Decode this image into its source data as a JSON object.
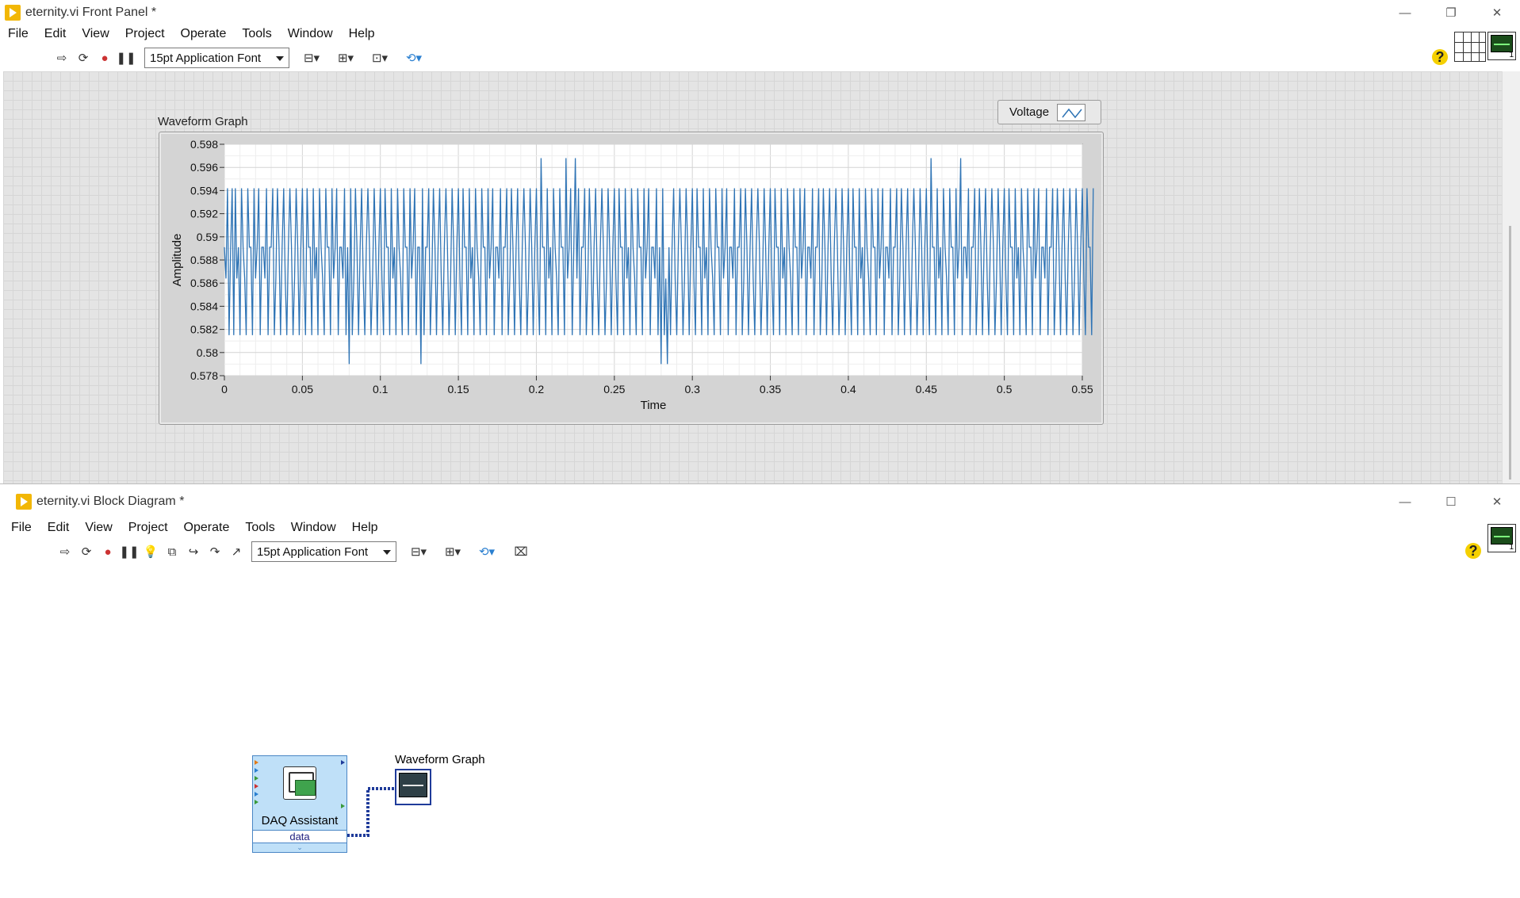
{
  "front_panel": {
    "title": "eternity.vi Front Panel *",
    "menu": [
      "File",
      "Edit",
      "View",
      "Project",
      "Operate",
      "Tools",
      "Window",
      "Help"
    ],
    "font_select": "15pt Application Font",
    "graph_label": "Waveform Graph",
    "legend_label": "Voltage"
  },
  "block_diagram": {
    "title": "eternity.vi Block Diagram *",
    "menu": [
      "File",
      "Edit",
      "View",
      "Project",
      "Operate",
      "Tools",
      "Window",
      "Help"
    ],
    "font_select": "15pt Application Font",
    "daq_title": "DAQ Assistant",
    "daq_output": "data",
    "graph_terminal_label": "Waveform Graph"
  },
  "window_controls": {
    "minimize": "—",
    "restore": "❐",
    "maximize": "☐",
    "close": "✕"
  },
  "chart_data": {
    "type": "line",
    "title": "Waveform Graph",
    "xlabel": "Time",
    "ylabel": "Amplitude",
    "xlim": [
      0,
      0.55
    ],
    "ylim": [
      0.578,
      0.598
    ],
    "xticks": [
      "0",
      "0.05",
      "0.1",
      "0.15",
      "0.2",
      "0.25",
      "0.3",
      "0.35",
      "0.4",
      "0.45",
      "0.5",
      "0.55"
    ],
    "yticks": [
      "0.578",
      "0.58",
      "0.582",
      "0.584",
      "0.586",
      "0.588",
      "0.59",
      "0.592",
      "0.594",
      "0.596",
      "0.598"
    ],
    "grid": true,
    "series": [
      {
        "name": "Voltage",
        "color": "#2f74b5",
        "x_start": 0,
        "x_step": 0.001,
        "values": [
          0.5891,
          0.5864,
          0.5942,
          0.5815,
          0.5891,
          0.5942,
          0.5815,
          0.5942,
          0.5864,
          0.5891,
          0.5815,
          0.5942,
          0.5891,
          0.5864,
          0.5815,
          0.5942,
          0.5891,
          0.5891,
          0.5815,
          0.5942,
          0.5864,
          0.5891,
          0.5942,
          0.5815,
          0.5891,
          0.5891,
          0.5864,
          0.5942,
          0.5815,
          0.5891,
          0.5891,
          0.5942,
          0.5815,
          0.5864,
          0.5942,
          0.5891,
          0.5815,
          0.5891,
          0.5942,
          0.5864,
          0.5815,
          0.5891,
          0.5942,
          0.5891,
          0.5815,
          0.5864,
          0.5942,
          0.5891,
          0.5815,
          0.5891,
          0.5942,
          0.5864,
          0.5815,
          0.5942,
          0.5891,
          0.5891,
          0.5815,
          0.5942,
          0.5864,
          0.5891,
          0.5815,
          0.5942,
          0.5891,
          0.5864,
          0.5815,
          0.5942,
          0.5891,
          0.5891,
          0.5815,
          0.5942,
          0.5864,
          0.5891,
          0.5942,
          0.5815,
          0.5891,
          0.5891,
          0.5864,
          0.5942,
          0.5815,
          0.5891,
          0.579,
          0.5942,
          0.5815,
          0.5864,
          0.5942,
          0.5891,
          0.5815,
          0.5891,
          0.5942,
          0.5864,
          0.5815,
          0.5891,
          0.5942,
          0.5891,
          0.5815,
          0.5864,
          0.5942,
          0.5891,
          0.5815,
          0.5891,
          0.5942,
          0.5864,
          0.5815,
          0.5942,
          0.5891,
          0.5891,
          0.5815,
          0.5942,
          0.5864,
          0.5891,
          0.5815,
          0.5942,
          0.5891,
          0.5864,
          0.5815,
          0.5942,
          0.5891,
          0.5891,
          0.5815,
          0.5942,
          0.5864,
          0.5891,
          0.5942,
          0.5815,
          0.5891,
          0.5891,
          0.579,
          0.5942,
          0.5815,
          0.5891,
          0.5891,
          0.5942,
          0.5815,
          0.5864,
          0.5942,
          0.5891,
          0.5815,
          0.5891,
          0.5942,
          0.5864,
          0.5815,
          0.5891,
          0.5942,
          0.5891,
          0.5815,
          0.5864,
          0.5942,
          0.5891,
          0.5815,
          0.5891,
          0.5942,
          0.5864,
          0.5815,
          0.5942,
          0.5891,
          0.5891,
          0.5815,
          0.5942,
          0.5864,
          0.5891,
          0.5815,
          0.5942,
          0.5891,
          0.5864,
          0.5815,
          0.5942,
          0.5891,
          0.5891,
          0.5815,
          0.5942,
          0.5864,
          0.5891,
          0.5942,
          0.5815,
          0.5891,
          0.5891,
          0.5864,
          0.5942,
          0.5815,
          0.5891,
          0.5891,
          0.5942,
          0.5815,
          0.5864,
          0.5942,
          0.5891,
          0.5815,
          0.5891,
          0.5942,
          0.5864,
          0.5815,
          0.5891,
          0.5942,
          0.5891,
          0.5815,
          0.5864,
          0.5942,
          0.5891,
          0.5815,
          0.5891,
          0.5942,
          0.5864,
          0.5815,
          0.5968,
          0.5891,
          0.5891,
          0.5815,
          0.5942,
          0.5864,
          0.5891,
          0.5815,
          0.5942,
          0.5891,
          0.5864,
          0.5815,
          0.5942,
          0.5891,
          0.5891,
          0.5815,
          0.5968,
          0.5864,
          0.5891,
          0.5942,
          0.5815,
          0.5891,
          0.5968,
          0.5864,
          0.5942,
          0.5815,
          0.5891,
          0.5891,
          0.5942,
          0.5815,
          0.5864,
          0.5942,
          0.5891,
          0.5815,
          0.5891,
          0.5942,
          0.5864,
          0.5815,
          0.5891,
          0.5942,
          0.5891,
          0.5815,
          0.5864,
          0.5942,
          0.5891,
          0.5815,
          0.5891,
          0.5942,
          0.5864,
          0.5815,
          0.5942,
          0.5891,
          0.5891,
          0.5815,
          0.5942,
          0.5864,
          0.5891,
          0.5815,
          0.5942,
          0.5891,
          0.5864,
          0.5815,
          0.5942,
          0.5891,
          0.5891,
          0.5815,
          0.5942,
          0.5864,
          0.5891,
          0.5942,
          0.5815,
          0.5891,
          0.5891,
          0.5864,
          0.5942,
          0.5815,
          0.5891,
          0.579,
          0.5942,
          0.5815,
          0.5864,
          0.579,
          0.5891,
          0.5815,
          0.5891,
          0.5942,
          0.5864,
          0.5815,
          0.5891,
          0.5942,
          0.5891,
          0.5815,
          0.5864,
          0.5942,
          0.5891,
          0.5815,
          0.5891,
          0.5942,
          0.5864,
          0.5815,
          0.5942,
          0.5891,
          0.5891,
          0.5815,
          0.5942,
          0.5864,
          0.5891,
          0.5815,
          0.5942,
          0.5891,
          0.5864,
          0.5815,
          0.5942,
          0.5891,
          0.5891,
          0.5815,
          0.5942,
          0.5864,
          0.5891,
          0.5942,
          0.5815,
          0.5891,
          0.5891,
          0.5864,
          0.5942,
          0.5815,
          0.5891,
          0.5891,
          0.5942,
          0.5815,
          0.5864,
          0.5942,
          0.5891,
          0.5815,
          0.5891,
          0.5942,
          0.5864,
          0.5815,
          0.5891,
          0.5942,
          0.5891,
          0.5815,
          0.5864,
          0.5942,
          0.5891,
          0.5815,
          0.5891,
          0.5942,
          0.5864,
          0.5815,
          0.5942,
          0.5891,
          0.5891,
          0.5815,
          0.5942,
          0.5864,
          0.5891,
          0.5815,
          0.5942,
          0.5891,
          0.5864,
          0.5815,
          0.5942,
          0.5891,
          0.5891,
          0.5815,
          0.5942,
          0.5864,
          0.5891,
          0.5942,
          0.5815,
          0.5891,
          0.5891,
          0.5864,
          0.5942,
          0.5815,
          0.5891,
          0.5891,
          0.5942,
          0.5815,
          0.5864,
          0.5942,
          0.5891,
          0.5815,
          0.5891,
          0.5942,
          0.5864,
          0.5815,
          0.5891,
          0.5942,
          0.5891,
          0.5815,
          0.5864,
          0.5942,
          0.5891,
          0.5815,
          0.5891,
          0.5942,
          0.5864,
          0.5815,
          0.5942,
          0.5891,
          0.5891,
          0.5815,
          0.5942,
          0.5864,
          0.5891,
          0.5815,
          0.5942,
          0.5891,
          0.5864,
          0.5815,
          0.5942,
          0.5891,
          0.5891,
          0.5815,
          0.5942,
          0.5864,
          0.5891,
          0.5942,
          0.5815,
          0.5891,
          0.5891,
          0.5864,
          0.5942,
          0.5815,
          0.5891,
          0.5891,
          0.5942,
          0.5815,
          0.5864,
          0.5942,
          0.5891,
          0.5815,
          0.5891,
          0.5942,
          0.5864,
          0.5815,
          0.5891,
          0.5942,
          0.5891,
          0.5815,
          0.5864,
          0.5942,
          0.5891,
          0.5815,
          0.5891,
          0.5942,
          0.5864,
          0.5815,
          0.5968,
          0.5891,
          0.5891,
          0.5815,
          0.5942,
          0.5864,
          0.5891,
          0.5815,
          0.5942,
          0.5891,
          0.5864,
          0.5815,
          0.5942,
          0.5891,
          0.5891,
          0.5815,
          0.5942,
          0.5864,
          0.5891,
          0.5968,
          0.5815,
          0.5891,
          0.5891,
          0.5864,
          0.5942,
          0.5815,
          0.5891,
          0.5891,
          0.5942,
          0.5815,
          0.5864,
          0.5942,
          0.5891,
          0.5815,
          0.5891,
          0.5942,
          0.5864,
          0.5815,
          0.5891,
          0.5942,
          0.5891,
          0.5815,
          0.5864,
          0.5942,
          0.5891,
          0.5815,
          0.5891,
          0.5942,
          0.5864,
          0.5815,
          0.5942,
          0.5891,
          0.5891,
          0.5815,
          0.5942,
          0.5864,
          0.5891,
          0.5815,
          0.5942,
          0.5891,
          0.5864,
          0.5815,
          0.5942,
          0.5891,
          0.5891,
          0.5815,
          0.5942,
          0.5864,
          0.5891,
          0.5942,
          0.5815,
          0.5891,
          0.5891,
          0.5864,
          0.5942,
          0.5815,
          0.5891,
          0.5891,
          0.5942,
          0.5815,
          0.5864,
          0.5942,
          0.5891,
          0.5815,
          0.5891,
          0.5942,
          0.5864,
          0.5815,
          0.5891,
          0.5942,
          0.5891,
          0.5815,
          0.5864,
          0.5942,
          0.5891,
          0.5815,
          0.5891,
          0.5942,
          0.5864,
          0.5815,
          0.5942,
          0.5891,
          0.5891,
          0.5815,
          0.5942
        ]
      }
    ]
  }
}
